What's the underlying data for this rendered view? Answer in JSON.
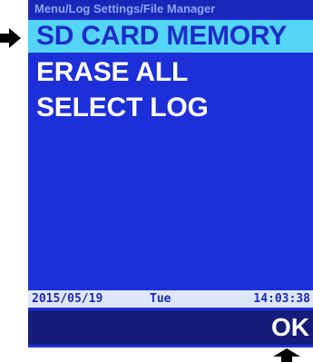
{
  "header": {
    "breadcrumb": "Menu/Log Settings/File Manager"
  },
  "menu": {
    "items": [
      {
        "label": "SD CARD MEMORY",
        "selected": true
      },
      {
        "label": "ERASE  ALL",
        "selected": false
      },
      {
        "label": "SELECT  LOG",
        "selected": false
      }
    ]
  },
  "status": {
    "date": "2015/05/19",
    "day": "Tue",
    "time": "14:03:38"
  },
  "softkeys": {
    "ok_label": "OK"
  },
  "indicators": {
    "left_pointer_icon": "arrow-right-icon",
    "bottom_pointer_icon": "arrow-up-icon"
  },
  "colors": {
    "screen_background": "#1c2fd8",
    "selected_item_background": "#54d4f6",
    "selected_item_text": "#1d2cc9",
    "menu_text": "#ffffff",
    "softkey_bar": "#161c7a",
    "status_bar": "#dee6fa"
  }
}
